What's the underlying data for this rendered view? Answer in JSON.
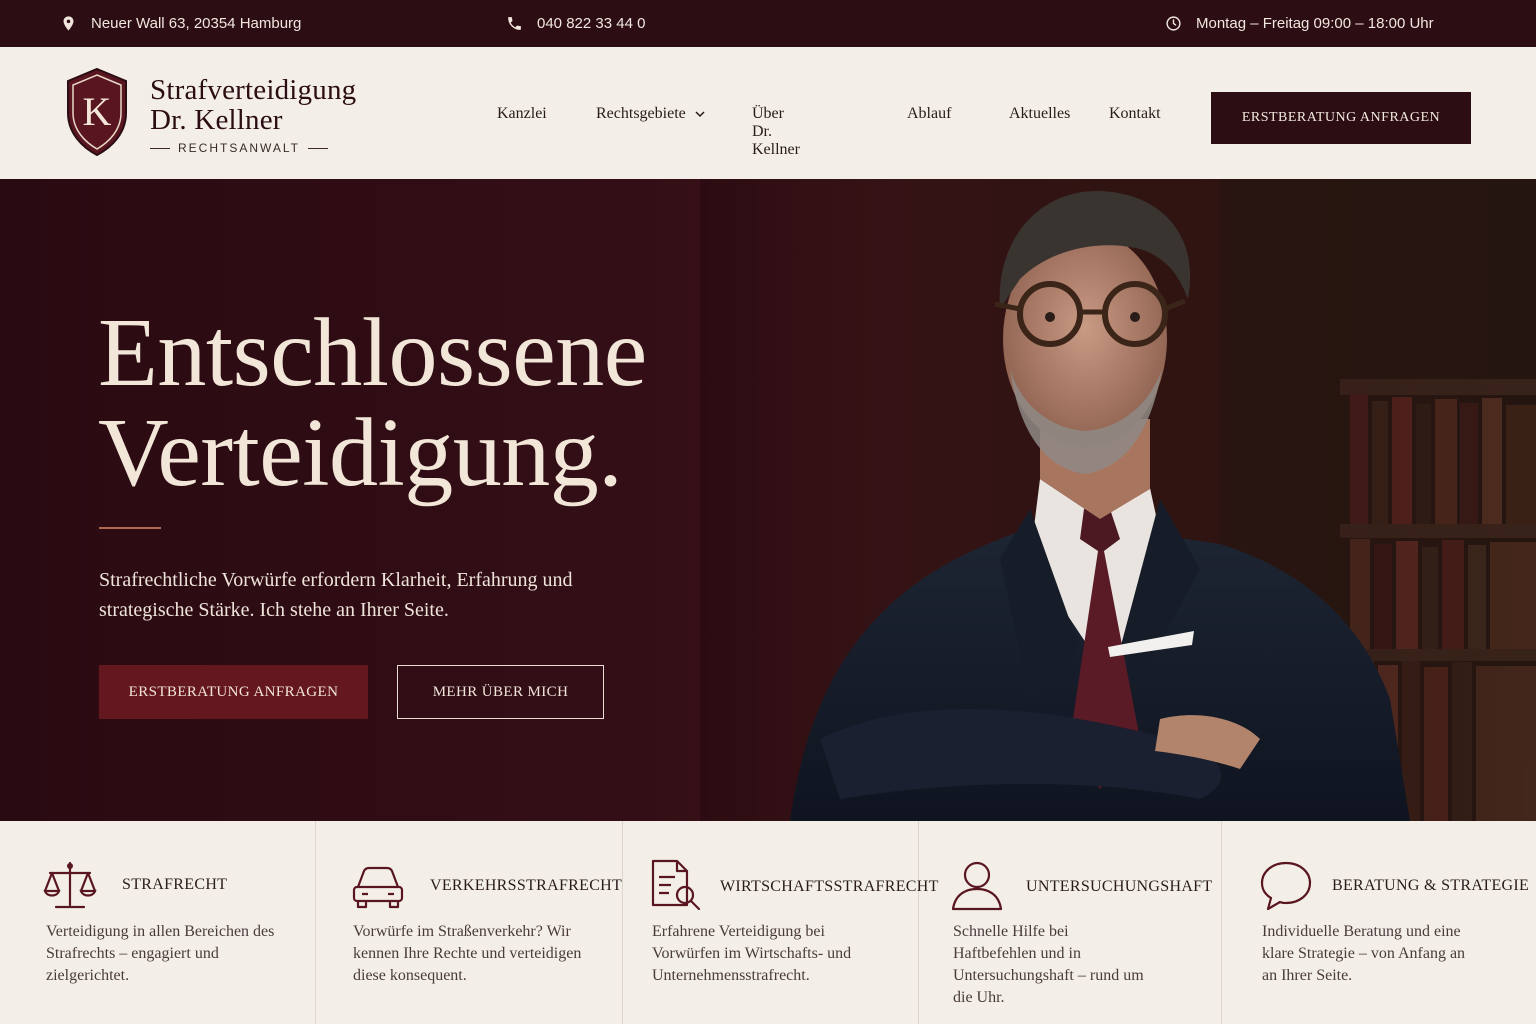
{
  "topbar": {
    "address": "Neuer Wall 63, 20354 Hamburg",
    "phone": "040 822 33 44 0",
    "hours": "Montag – Freitag 09:00 – 18:00 Uhr",
    "icons": [
      "location-pin-icon",
      "phone-icon",
      "clock-icon"
    ]
  },
  "logo": {
    "monogram": "K",
    "line1": "Strafverteidigung",
    "line2": "Dr. Kellner",
    "sub": "RECHTSANWALT"
  },
  "nav": {
    "items": [
      "Kanzlei",
      "Rechtsgebiete",
      "Über Dr. Kellner",
      "Ablauf",
      "Aktuelles",
      "Kontakt"
    ],
    "cta": "ERSTBERATUNG ANFRAGEN"
  },
  "hero": {
    "title_line1": "Entschlossene",
    "title_line2": "Verteidigung.",
    "lead": "Strafrechtliche Vorwürfe erfordern Klarheit, Erfahrung und strategische Stärke. Ich stehe an Ihrer Seite.",
    "primary_button": "ERSTBERATUNG ANFRAGEN",
    "secondary_button": "MEHR ÜBER MICH"
  },
  "cards": [
    {
      "icon": "scales-icon",
      "title": "STRAFRECHT",
      "desc": "Verteidigung in allen Bereichen des Strafrechts – engagiert und zielgerichtet."
    },
    {
      "icon": "car-icon",
      "title": "VERKEHRSSTRAFRECHT",
      "desc": "Vorwürfe im Straßenverkehr? Wir kennen Ihre Rechte und verteidigen diese konsequent."
    },
    {
      "icon": "document-search-icon",
      "title": "WIRTSCHAFTSSTRAFRECHT",
      "desc": "Erfahrene Verteidigung bei Vorwürfen im Wirtschafts- und Unternehmensstrafrecht."
    },
    {
      "icon": "person-icon",
      "title": "UNTERSUCHUNGSHAFT",
      "desc": "Schnelle Hilfe bei Haftbefehlen und in Untersuchungshaft – rund um die Uhr."
    },
    {
      "icon": "speech-bubble-icon",
      "title": "BERATUNG & STRATEGIE",
      "desc": "Individuelle Beratung und eine klare Strategie – von Anfang an an Ihrer Seite."
    }
  ],
  "colors": {
    "brand_dark": "#2c0d14",
    "brand_red": "#64171f",
    "cream": "#f3efe8",
    "accent_copper": "#b06a4d"
  }
}
